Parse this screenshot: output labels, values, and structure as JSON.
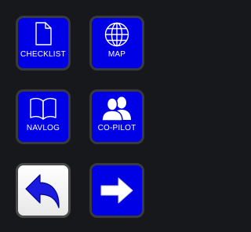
{
  "tiles": {
    "checklist": {
      "label": "CHECKLIST",
      "icon": "document-icon"
    },
    "map": {
      "label": "MAP",
      "icon": "globe-icon"
    },
    "navlog": {
      "label": "NAVLOG",
      "icon": "open-book-icon"
    },
    "copilot": {
      "label": "CO-PILOT",
      "icon": "people-icon"
    },
    "back": {
      "icon": "back-arrow-icon"
    },
    "next": {
      "icon": "right-arrow-icon"
    }
  },
  "colors": {
    "background": "#16181b",
    "tile_blue": "#0000e6",
    "tile_border": "#3a3a3a",
    "tile_white": "#ffffff",
    "icon_white": "#ffffff",
    "back_arrow_blue": "#1a1ae0"
  }
}
